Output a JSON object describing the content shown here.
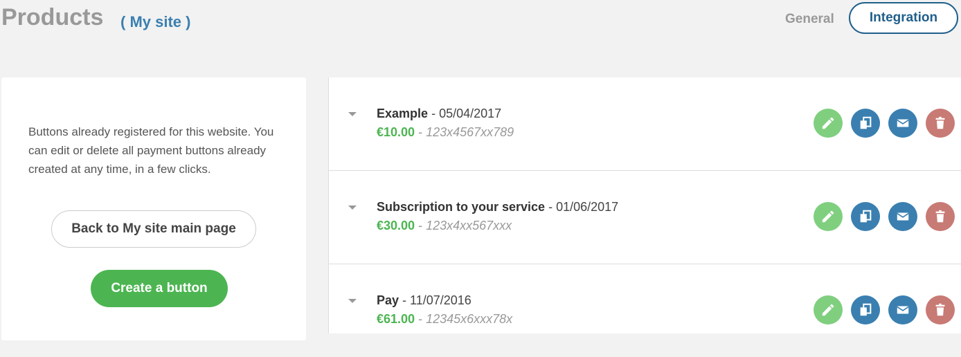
{
  "header": {
    "title": "Products",
    "site": "( My site )",
    "tabs": [
      {
        "label": "General",
        "active": false
      },
      {
        "label": "Integration",
        "active": true
      }
    ]
  },
  "sidebar": {
    "description": "Buttons already registered for this website. You can edit or delete all payment buttons already created at any time, in a few clicks.",
    "back_label": "Back to My site main page",
    "create_label": "Create a button"
  },
  "products": [
    {
      "name": "Example",
      "date": "05/04/2017",
      "price": "€10.00",
      "ref": "123x4567xx789"
    },
    {
      "name": "Subscription to your service",
      "date": "01/06/2017",
      "price": "€30.00",
      "ref": "123x4xx567xxx"
    },
    {
      "name": "Pay",
      "date": "11/07/2016",
      "price": "€61.00",
      "ref": "12345x6xxx78x"
    }
  ],
  "icons": {
    "caret": "caret-down-icon",
    "edit": "pencil-icon",
    "copy": "copy-icon",
    "mail": "envelope-icon",
    "delete": "trash-icon"
  },
  "colors": {
    "accent_green": "#4cb551",
    "accent_blue": "#3a7fb0",
    "integration_tab_border": "#1f5f8b",
    "edit_green": "#7fcf7f",
    "delete_red": "#c87a74"
  }
}
